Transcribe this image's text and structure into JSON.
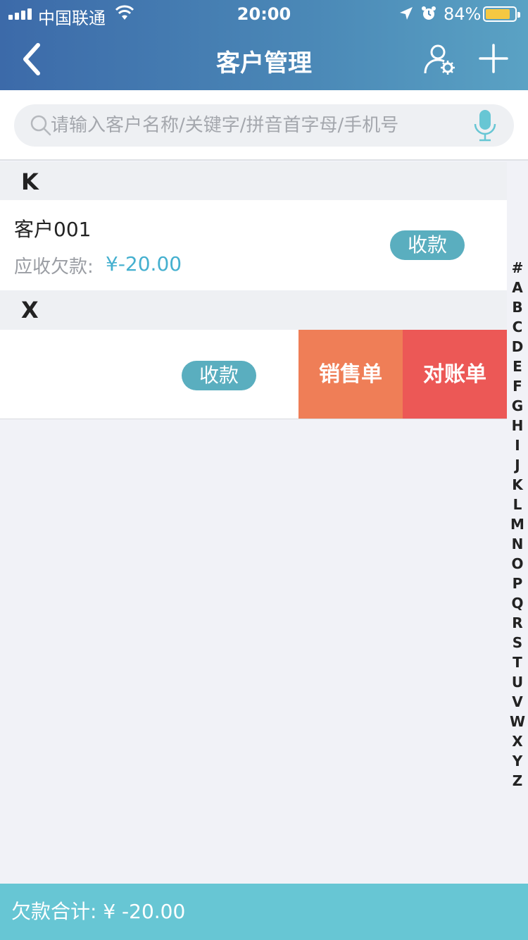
{
  "status_bar": {
    "carrier": "中国联通",
    "time": "20:00",
    "battery_percent": "84%",
    "battery_level": 0.84,
    "icons": [
      "signal-icon",
      "wifi-icon",
      "location-arrow-icon",
      "alarm-icon",
      "battery-icon"
    ]
  },
  "header": {
    "title": "客户管理",
    "back_icon": "chevron-left-icon",
    "user_settings_icon": "user-settings-icon",
    "add_icon": "plus-icon"
  },
  "search": {
    "placeholder": "请输入客户名称/关键字/拼音首字母/手机号",
    "value": "",
    "icons": [
      "search-icon",
      "mic-icon"
    ]
  },
  "sections": [
    {
      "letter": "K",
      "customers": [
        {
          "name": "客户001",
          "debt_label": "应收欠款:",
          "debt_value": "¥-20.00",
          "collect_label": "收款"
        }
      ]
    },
    {
      "letter": "X",
      "customers": [
        {
          "collect_label": "收款",
          "actions": [
            "销售单",
            "对账单"
          ]
        }
      ]
    }
  ],
  "index_letters": [
    "#",
    "A",
    "B",
    "C",
    "D",
    "E",
    "F",
    "G",
    "H",
    "I",
    "J",
    "K",
    "L",
    "M",
    "N",
    "O",
    "P",
    "Q",
    "R",
    "S",
    "T",
    "U",
    "V",
    "W",
    "X",
    "Y",
    "Z"
  ],
  "footer": {
    "total_label": "欠款合计: ¥ -20.00"
  },
  "colors": {
    "header_gradient_start": "#3c6aa9",
    "header_gradient_end": "#5aa2c4",
    "collect_button": "#5aaebf",
    "debt_value": "#45b0cf",
    "sales_action": "#ef7e57",
    "reconcile_action": "#ec5856",
    "footer": "#67c6d4",
    "battery_fill": "#f5c842"
  }
}
